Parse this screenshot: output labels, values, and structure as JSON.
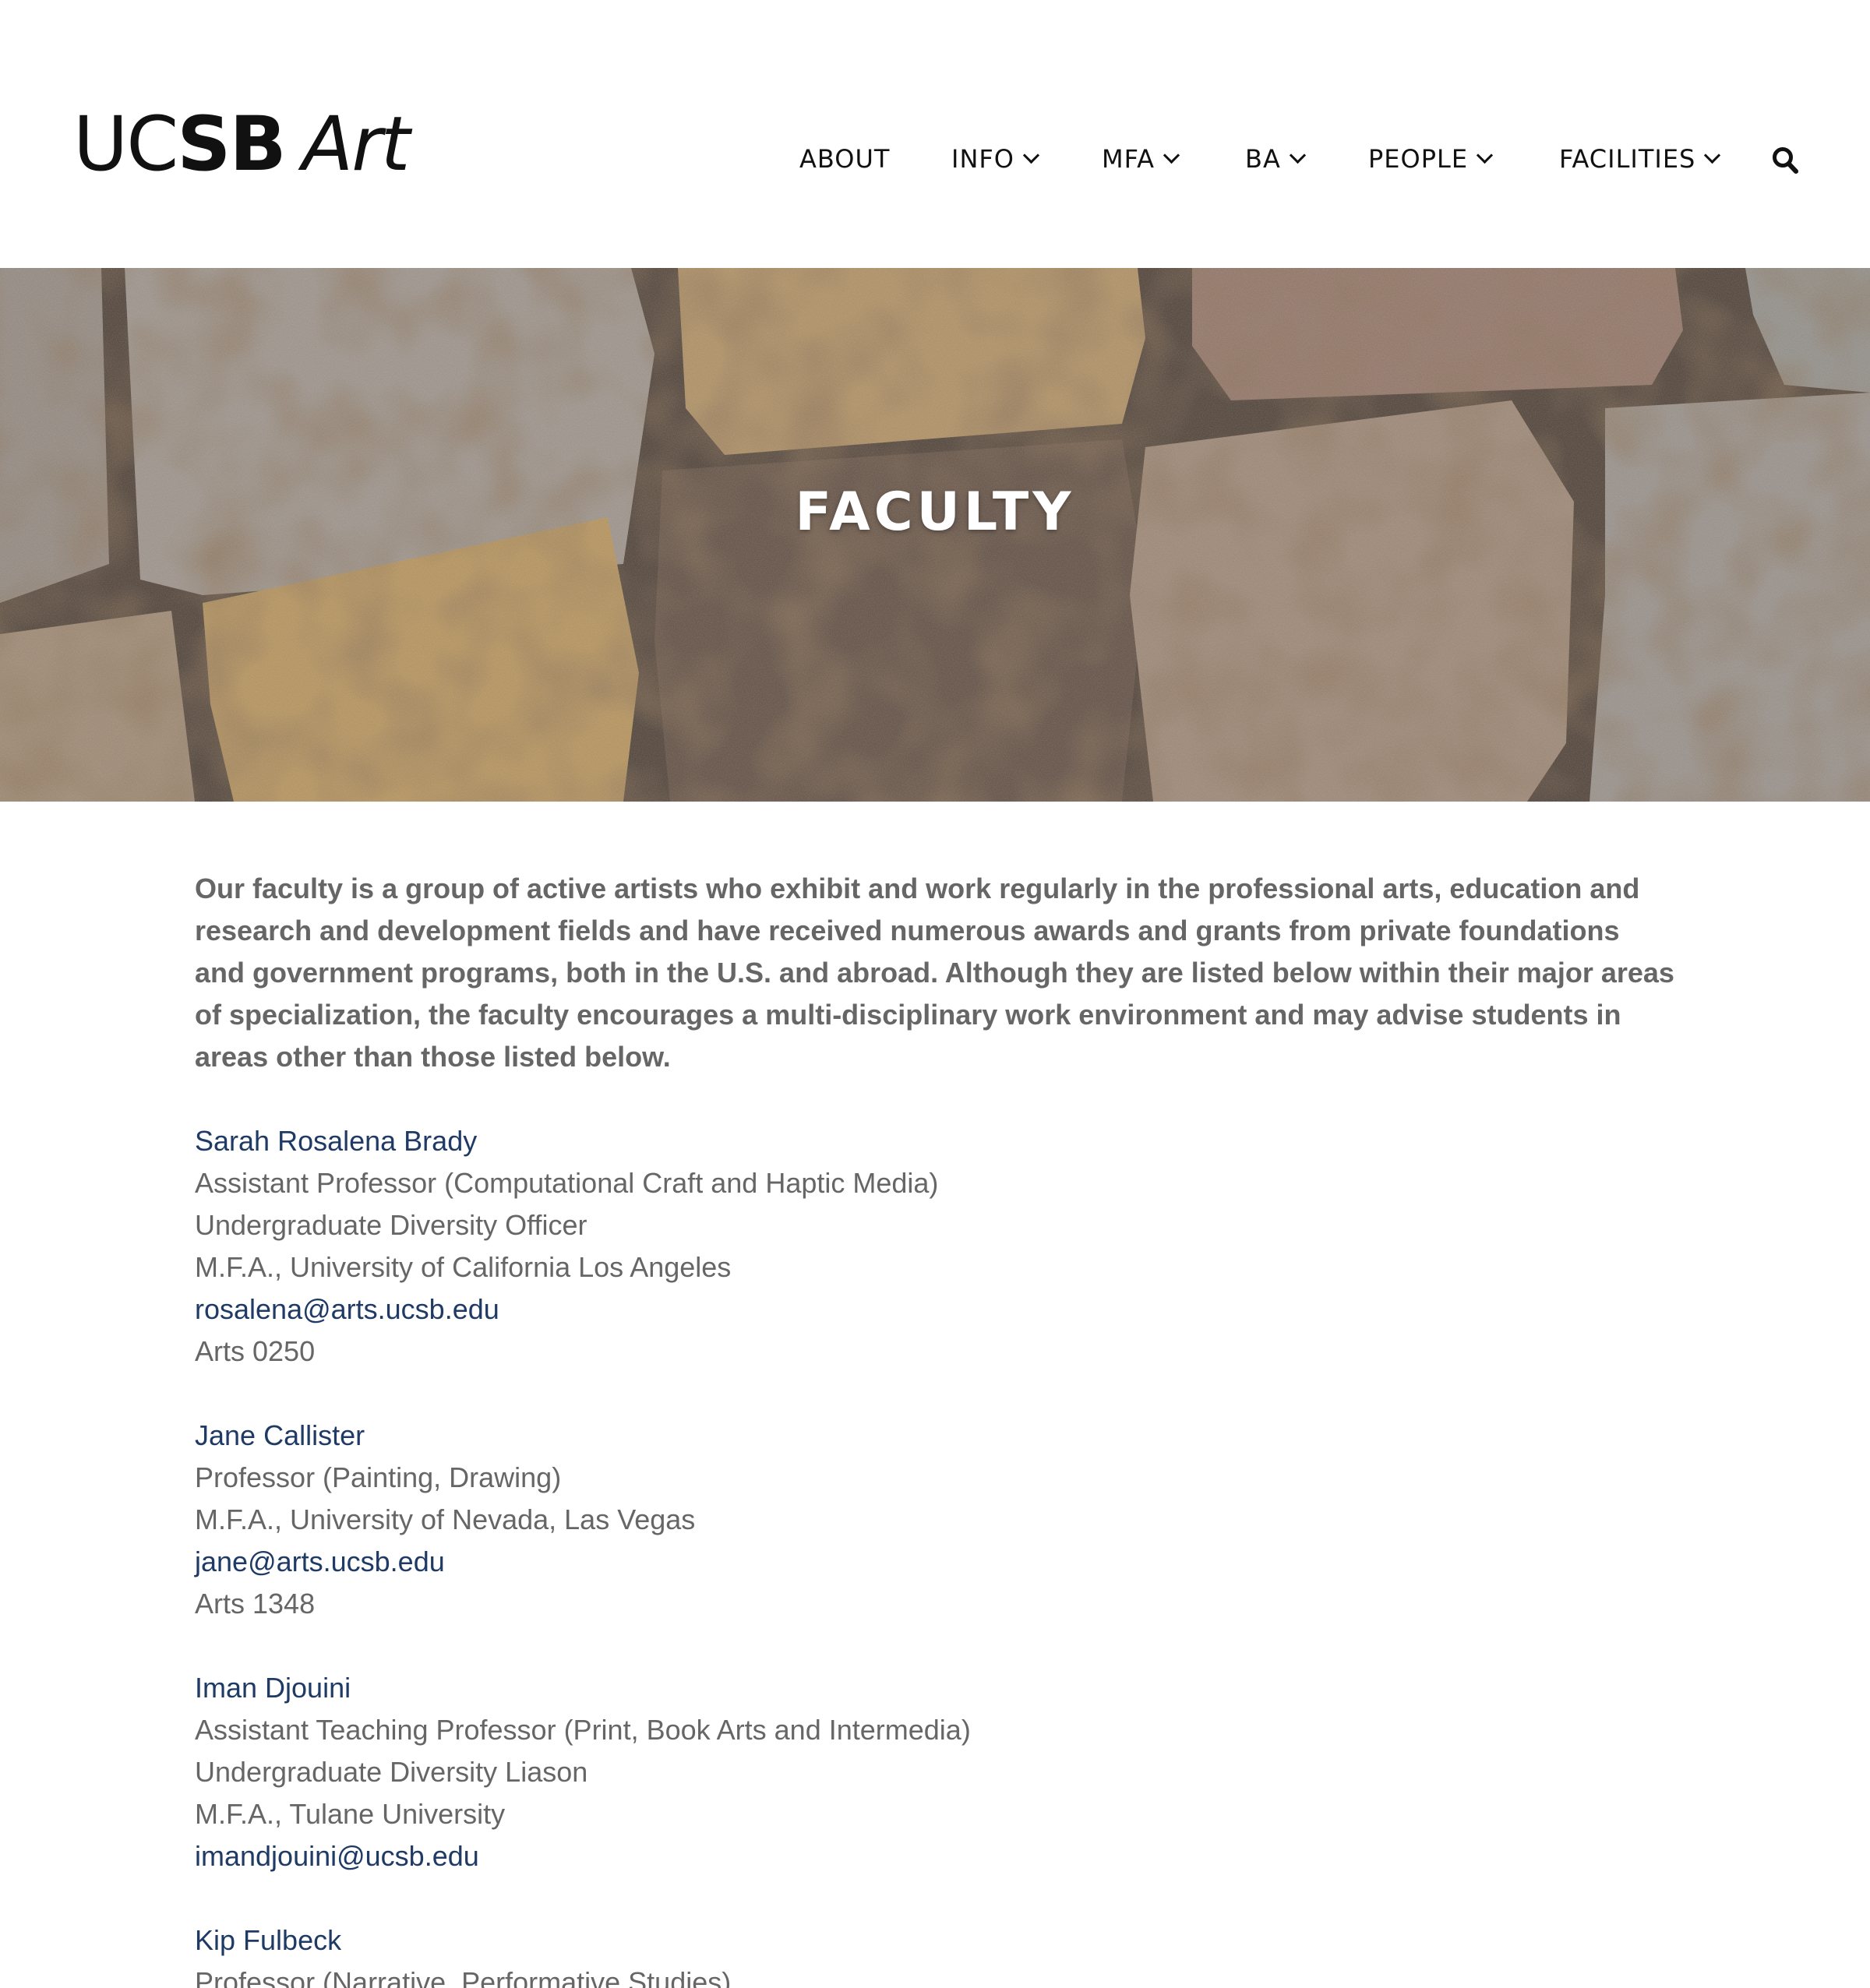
{
  "site": {
    "logo": {
      "uc": "UC",
      "sb": "SB",
      "art": "Art"
    }
  },
  "nav": {
    "items": [
      {
        "label": "ABOUT",
        "dropdown": false
      },
      {
        "label": "INFO",
        "dropdown": true
      },
      {
        "label": "MFA",
        "dropdown": true
      },
      {
        "label": "BA",
        "dropdown": true
      },
      {
        "label": "PEOPLE",
        "dropdown": true
      },
      {
        "label": "FACILITIES",
        "dropdown": true
      }
    ],
    "search_icon": "search-icon"
  },
  "hero": {
    "title": "FACULTY"
  },
  "intro": "Our faculty is a group of active artists who exhibit and work regularly in the professional arts, education and research and development fields and have received numerous awards and grants from private foundations and government programs, both in the U.S. and abroad. Although they are listed below within their major areas of specialization, the faculty encourages a multi-disciplinary work environment and may advise students in areas other than those listed below.",
  "faculty": [
    {
      "name": "Sarah Rosalena Brady",
      "title": "Assistant Professor (Computational Craft and Haptic Media)",
      "role": "Undergraduate Diversity Officer",
      "degree": "M.F.A., University of California Los Angeles",
      "email": "rosalena@arts.ucsb.edu",
      "office": "Arts 0250"
    },
    {
      "name": "Jane Callister",
      "title": "Professor (Painting, Drawing)",
      "degree": "M.F.A., University of Nevada, Las Vegas",
      "email": "jane@arts.ucsb.edu",
      "office": "Arts 1348"
    },
    {
      "name": "Iman Djouini",
      "title": "Assistant Teaching Professor (Print, Book Arts and Intermedia)",
      "role": "Undergraduate Diversity Liason",
      "degree": "M.F.A., Tulane University",
      "email": "imandjouini@ucsb.edu"
    },
    {
      "name": "Kip Fulbeck",
      "title": "Professor (Narrative, Performative Studies)"
    }
  ],
  "colors": {
    "link": "#1f3a64",
    "text": "#666666",
    "nav_text": "#111111",
    "hero_title": "#ffffff"
  }
}
